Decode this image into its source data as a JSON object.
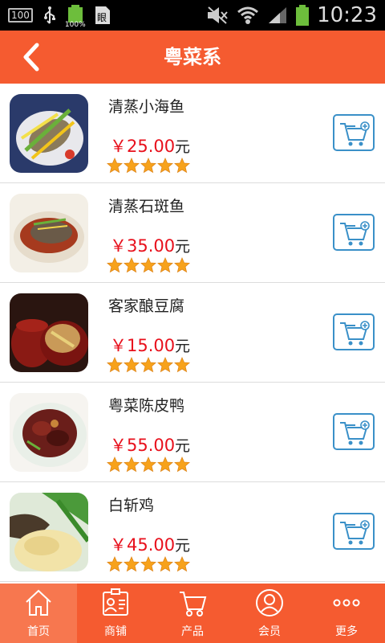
{
  "status_bar": {
    "storage_badge": "100",
    "battery_percent": "100%",
    "time": "10:23",
    "icons": [
      "usb-icon",
      "battery-icon",
      "sim-icon",
      "mute-icon",
      "wifi-icon",
      "signal-icon",
      "battery-full-icon"
    ]
  },
  "header": {
    "title": "粤菜系",
    "back_icon": "chevron-left-icon",
    "bg_color": "#f55b30"
  },
  "dishes": [
    {
      "name": "清蒸小海鱼",
      "price": "￥25.00",
      "unit": "元",
      "rating": 5,
      "rating_max": 5
    },
    {
      "name": "清蒸石斑鱼",
      "price": "￥35.00",
      "unit": "元",
      "rating": 5,
      "rating_max": 5
    },
    {
      "name": "客家酿豆腐",
      "price": "￥15.00",
      "unit": "元",
      "rating": 5,
      "rating_max": 5
    },
    {
      "name": "粤菜陈皮鸭",
      "price": "￥55.00",
      "unit": "元",
      "rating": 5,
      "rating_max": 5
    },
    {
      "name": "白斩鸡",
      "price": "￥45.00",
      "unit": "元",
      "rating": 5,
      "rating_max": 5
    }
  ],
  "colors": {
    "accent": "#f55b30",
    "price": "#e8101c",
    "star": "#f7a21b",
    "cart_border": "#3a90c8"
  },
  "bottom_nav": {
    "items": [
      {
        "label": "首页",
        "icon": "home-icon",
        "active": true
      },
      {
        "label": "商铺",
        "icon": "shop-card-icon",
        "active": false
      },
      {
        "label": "产品",
        "icon": "cart-icon",
        "active": false
      },
      {
        "label": "会员",
        "icon": "member-icon",
        "active": false
      },
      {
        "label": "更多",
        "icon": "more-dots-icon",
        "active": false
      }
    ]
  }
}
